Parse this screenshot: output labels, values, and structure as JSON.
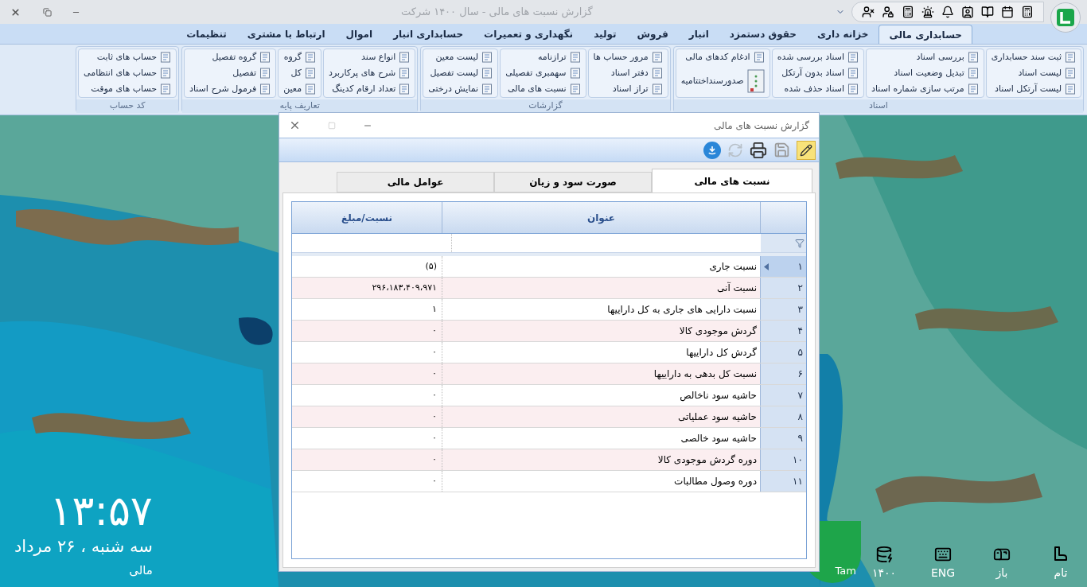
{
  "app": {
    "title": "گزارش نسبت های مالی - سال ۱۴۰۰ شرکت"
  },
  "ribbon": {
    "tabs": [
      {
        "label": "حسابداری مالی",
        "selected": true
      },
      {
        "label": "خزانه داری",
        "selected": false
      },
      {
        "label": "حقوق دستمزد",
        "selected": false
      },
      {
        "label": "انبار",
        "selected": false
      },
      {
        "label": "فروش",
        "selected": false
      },
      {
        "label": "تولید",
        "selected": false
      },
      {
        "label": "نگهداری و تعمیرات",
        "selected": false
      },
      {
        "label": "حسابداری انبار",
        "selected": false
      },
      {
        "label": "اموال",
        "selected": false
      },
      {
        "label": "ارتباط با مشتری",
        "selected": false
      },
      {
        "label": "تنظیمات",
        "selected": false
      }
    ],
    "groups": [
      {
        "label": "اسناد",
        "columns": [
          [
            {
              "label": "ثبت سند حسابداری",
              "kind": "small"
            },
            {
              "label": "لیست اسناد",
              "kind": "small"
            },
            {
              "label": "لیست آرتکل اسناد",
              "kind": "small"
            }
          ],
          [
            {
              "label": "بررسی اسناد",
              "kind": "small"
            },
            {
              "label": "تبدیل وضعیت اسناد",
              "kind": "small"
            },
            {
              "label": "مرتب سازی شماره اسناد",
              "kind": "small"
            }
          ],
          [
            {
              "label": "اسناد بررسی شده",
              "kind": "small"
            },
            {
              "label": "اسناد بدون آرتکل",
              "kind": "small"
            },
            {
              "label": "اسناد حذف شده",
              "kind": "small"
            }
          ],
          [
            {
              "label": "ادغام کدهای مالی",
              "kind": "small"
            },
            {
              "label": "صدورسنداختتامیه",
              "kind": "large"
            }
          ]
        ]
      },
      {
        "label": "گزارشات",
        "columns": [
          [
            {
              "label": "مرور حساب ها",
              "kind": "small"
            },
            {
              "label": "دفتر اسناد",
              "kind": "small"
            },
            {
              "label": "تراز اسناد",
              "kind": "small"
            }
          ],
          [
            {
              "label": "ترازنامه",
              "kind": "small"
            },
            {
              "label": "سهمبری تفصیلی",
              "kind": "small"
            },
            {
              "label": "نسبت های مالی",
              "kind": "small"
            }
          ],
          [
            {
              "label": "لیست معین",
              "kind": "small"
            },
            {
              "label": "لیست تفصیل",
              "kind": "small"
            },
            {
              "label": "نمایش درختی",
              "kind": "small"
            }
          ]
        ]
      },
      {
        "label": "تعاریف پایه",
        "columns": [
          [
            {
              "label": "انواع سند",
              "kind": "small"
            },
            {
              "label": "شرح های پرکاربرد",
              "kind": "small"
            },
            {
              "label": "تعداد ارقام کدینگ",
              "kind": "small"
            }
          ],
          [
            {
              "label": "گروه",
              "kind": "small"
            },
            {
              "label": "کل",
              "kind": "small"
            },
            {
              "label": "معین",
              "kind": "small"
            }
          ],
          [
            {
              "label": "گروه تفصیل",
              "kind": "small"
            },
            {
              "label": "تفصیل",
              "kind": "small"
            },
            {
              "label": "فرمول شرح اسناد",
              "kind": "small"
            }
          ]
        ]
      },
      {
        "label": "کد حساب",
        "columns": [
          [
            {
              "label": "حساب های ثابت",
              "kind": "small"
            },
            {
              "label": "حساب های انتظامی",
              "kind": "small"
            },
            {
              "label": "حساب های موقت",
              "kind": "small"
            }
          ]
        ]
      }
    ]
  },
  "dialog": {
    "title": "گزارش نسبت های مالی",
    "tabs": [
      {
        "label": "نسبت های مالی",
        "selected": true
      },
      {
        "label": "صورت سود و زیان",
        "selected": false
      },
      {
        "label": "عوامل مالی",
        "selected": false
      }
    ],
    "table": {
      "columns": [
        "عنوان",
        "نسبت/مبلغ"
      ],
      "rows": [
        {
          "number": "۱",
          "title": "نسبت جاری",
          "value": "(۵)",
          "selected": true
        },
        {
          "number": "۲",
          "title": "نسبت آنی",
          "value": "۲۹۶،۱۸۳،۴۰۹،۹۷۱",
          "selected": false
        },
        {
          "number": "۳",
          "title": "نسبت دارایی های جاری به کل داراییها",
          "value": "۱",
          "selected": false
        },
        {
          "number": "۴",
          "title": "گردش موجودی کالا",
          "value": "۰",
          "selected": false
        },
        {
          "number": "۵",
          "title": "گردش کل داراییها",
          "value": "۰",
          "selected": false
        },
        {
          "number": "۶",
          "title": "نسبت کل بدهی به داراییها",
          "value": "۰",
          "selected": false
        },
        {
          "number": "۷",
          "title": "حاشیه سود ناخالص",
          "value": "۰",
          "selected": false
        },
        {
          "number": "۸",
          "title": "حاشیه سود عملیاتی",
          "value": "۰",
          "selected": false
        },
        {
          "number": "۹",
          "title": "حاشیه سود خالصی",
          "value": "۰",
          "selected": false
        },
        {
          "number": "۱۰",
          "title": "دوره گردش موجودی کالا",
          "value": "۰",
          "selected": false
        },
        {
          "number": "۱۱",
          "title": "دوره وصول مطالبات",
          "value": "۰",
          "selected": false
        }
      ]
    }
  },
  "desktop": {
    "time": "۱۳:۵۷",
    "date": "سه شنبه ، ۲۶ مرداد",
    "caption": "مالی",
    "logo_text": "Tam",
    "tray": [
      {
        "kind": "boot",
        "label": "تام"
      },
      {
        "kind": "mailbox",
        "label": "باز"
      },
      {
        "kind": "keyboard",
        "label": "ENG"
      },
      {
        "kind": "database",
        "label": "۱۴۰۰"
      }
    ]
  }
}
